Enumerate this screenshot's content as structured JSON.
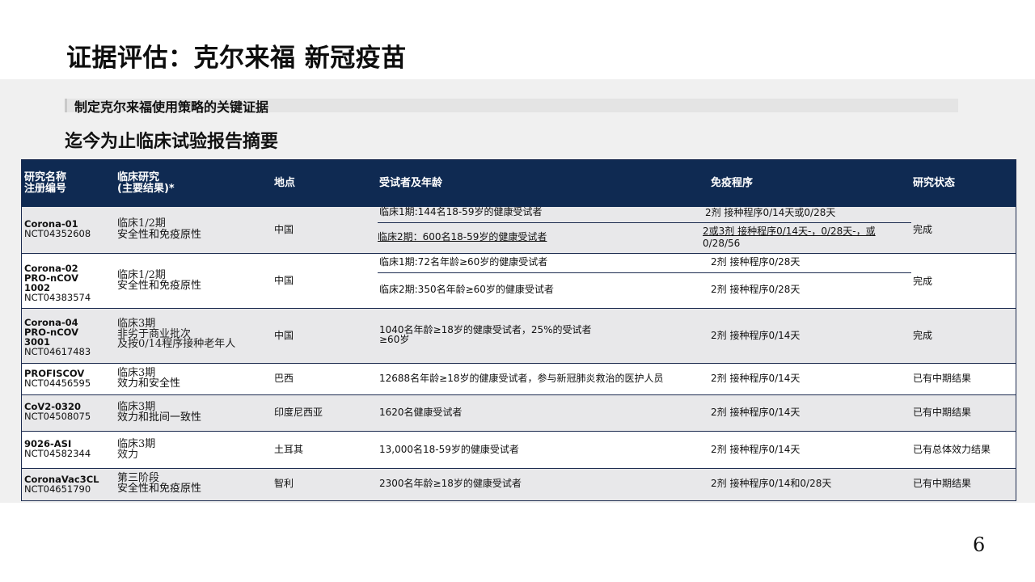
{
  "page": {
    "title": "证据评估：克尔来福 新冠疫苗",
    "subtitle": "制定克尔来福使用策略的关键证据",
    "section_title": "迄今为止临床试验报告摘要",
    "page_number": "6"
  },
  "table": {
    "headers": {
      "study_line1": "研究名称",
      "study_line2": "注册编号",
      "trial_line1": "临床研究",
      "trial_line2": "(主要结果)*",
      "location": "地点",
      "subjects": "受试者及年龄",
      "schedule": "免疫程序",
      "status": "研究状态"
    },
    "rows": [
      {
        "study_lines": [
          "Corona-01",
          "NCT04352608"
        ],
        "phase": "临床1/2期",
        "endpoint": [
          "安全性和免疫原性"
        ],
        "location": "中国",
        "subjects": [
          "临床1期:144名18-59岁的健康受试者",
          "临床2期：600名18-59岁的健康受试者"
        ],
        "schedule": [
          "2剂    接种程序0/14天或0/28天",
          "2或3剂  接种程序0/14天-，0/28天-，或",
          "0/28/56"
        ],
        "status": "完成"
      },
      {
        "study_lines": [
          "Corona-02",
          "PRO-nCOV",
          "1002",
          "NCT04383574"
        ],
        "phase": "临床1/2期",
        "endpoint": [
          "安全性和免疫原性"
        ],
        "location": "中国",
        "subjects": [
          "临床1期:72名年龄≥60岁的健康受试者",
          "临床2期:350名年龄≥60岁的健康受试者"
        ],
        "schedule": [
          "2剂 接种程序0/28天",
          "2剂 接种程序0/28天"
        ],
        "status": "完成"
      },
      {
        "study_lines": [
          "Corona-04",
          "PRO-nCOV",
          "3001",
          "NCT04617483"
        ],
        "phase": "临床3期",
        "endpoint": [
          "非劣于商业批次",
          "及按0/14程序接种老年人"
        ],
        "location": "中国",
        "subjects": [
          "1040名年龄≥18岁的健康受试者，25%的受试者",
          "≥60岁"
        ],
        "schedule": [
          "2剂 接种程序0/14天"
        ],
        "status": "完成"
      },
      {
        "study_lines": [
          "PROFISCOV",
          "NCT04456595"
        ],
        "phase": "临床3期",
        "endpoint": [
          "效力和安全性"
        ],
        "location": "巴西",
        "subjects": [
          "12688名年龄≥18岁的健康受试者，参与新冠肺炎救治的医护人员"
        ],
        "schedule": [
          "2剂 接种程序0/14天"
        ],
        "status": "已有中期结果"
      },
      {
        "study_lines": [
          "CoV2-0320",
          "NCT04508075"
        ],
        "phase": "临床3期",
        "endpoint": [
          "效力和批间一致性"
        ],
        "location": "印度尼西亚",
        "subjects": [
          "1620名健康受试者"
        ],
        "schedule": [
          "2剂 接种程序0/14天"
        ],
        "status": "已有中期结果"
      },
      {
        "study_lines": [
          "9026-ASI",
          "NCT04582344"
        ],
        "phase": "临床3期",
        "endpoint": [
          "效力"
        ],
        "location": "土耳其",
        "subjects": [
          "13,000名18-59岁的健康受试者"
        ],
        "schedule": [
          "2剂 接种程序0/14天"
        ],
        "status": "已有总体效力结果"
      },
      {
        "study_lines": [
          "CoronaVac3CL",
          "NCT04651790"
        ],
        "phase": "第三阶段",
        "endpoint": [
          "安全性和免疫原性"
        ],
        "location": "智利",
        "subjects": [
          "2300名年龄≥18岁的健康受试者"
        ],
        "schedule": [
          "2剂 接种程序0/14和0/28天"
        ],
        "status": "已有中期结果"
      }
    ]
  }
}
